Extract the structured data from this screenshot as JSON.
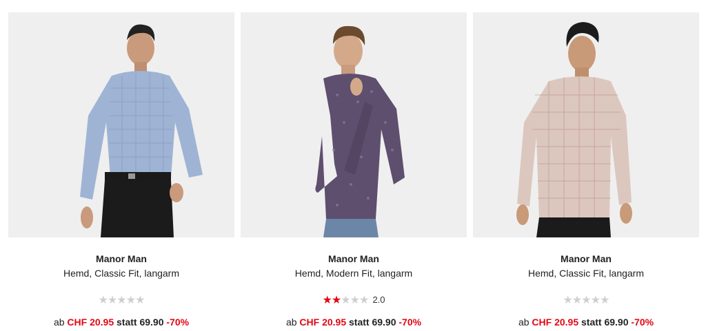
{
  "products": [
    {
      "brand": "Manor Man",
      "description": "Hemd, Classic Fit, langarm",
      "rating": 0,
      "rating_label": "",
      "price_prefix": "ab",
      "price": "CHF 20.95",
      "old_price_label": "statt 69.90",
      "discount": "-70%",
      "shirt_color": "#9fb4d4",
      "image_alt": "blue checked shirt"
    },
    {
      "brand": "Manor Man",
      "description": "Hemd, Modern Fit, langarm",
      "rating": 2,
      "rating_label": "2.0",
      "price_prefix": "ab",
      "price": "CHF 20.95",
      "old_price_label": "statt 69.90",
      "discount": "-70%",
      "shirt_color": "#5e4f6e",
      "image_alt": "purple patterned shirt"
    },
    {
      "brand": "Manor Man",
      "description": "Hemd, Classic Fit, langarm",
      "rating": 0,
      "rating_label": "",
      "price_prefix": "ab",
      "price": "CHF 20.95",
      "old_price_label": "statt 69.90",
      "discount": "-70%",
      "shirt_color": "#d9c4bd",
      "image_alt": "beige checked shirt"
    }
  ],
  "colors": {
    "accent": "#e30613",
    "star_off": "#cfcfcf",
    "image_bg": "#efefef"
  }
}
